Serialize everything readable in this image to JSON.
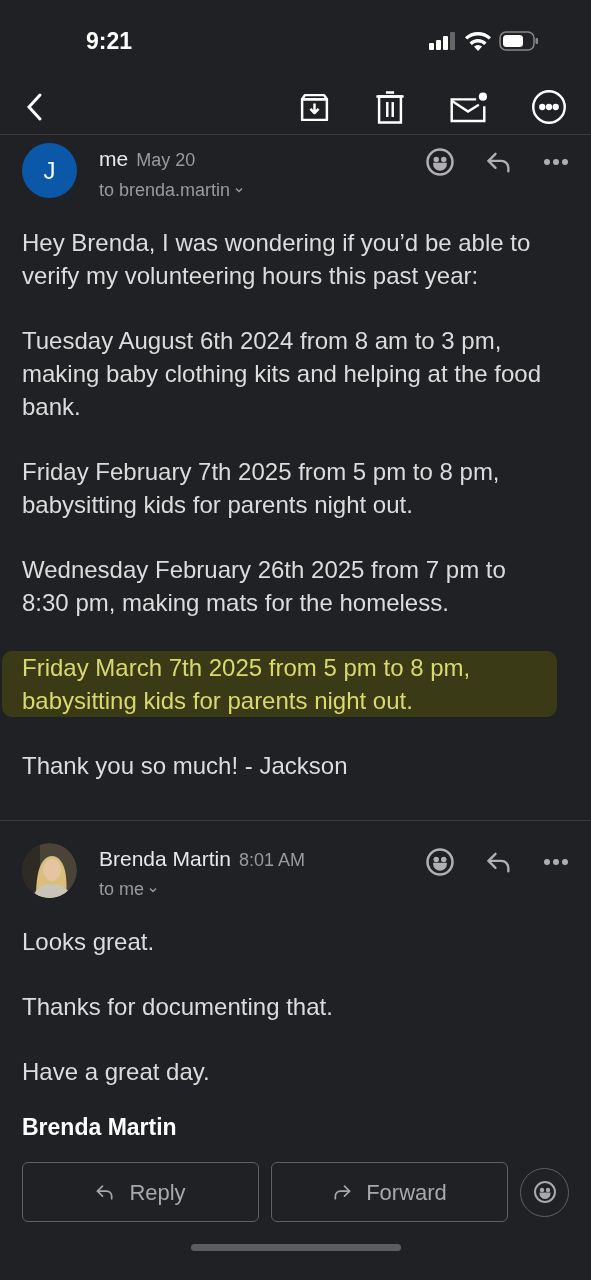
{
  "status_bar": {
    "time": "9:21"
  },
  "messages": [
    {
      "avatar": {
        "kind": "initial",
        "text": "J"
      },
      "sender": "me",
      "date": "May 20",
      "recipient": "to brenda.martin",
      "paragraphs": [
        {
          "text": "Hey Brenda, I was wondering if you’d be able to verify my volunteering hours this past year:",
          "highlighted": false
        },
        {
          "text": "Tuesday August 6th 2024 from 8 am to 3 pm, making baby clothing kits and helping at the food bank.",
          "highlighted": false
        },
        {
          "text": "Friday February 7th 2025 from 5 pm to 8 pm, babysitting kids for parents night out.",
          "highlighted": false
        },
        {
          "text": "Wednesday February 26th 2025 from 7 pm to 8:30 pm, making mats for the homeless.",
          "highlighted": false
        },
        {
          "text": "Friday March 7th 2025 from 5 pm to 8 pm, babysitting kids for parents night out.",
          "highlighted": true
        },
        {
          "text": "Thank you so much! - Jackson",
          "highlighted": false
        }
      ]
    },
    {
      "sender": "Brenda Martin",
      "date": "8:01 AM",
      "recipient": "to me",
      "paragraphs": [
        {
          "text": "Looks great.",
          "highlighted": false
        },
        {
          "text": "Thanks for documenting that.",
          "highlighted": false
        },
        {
          "text": "Have a great day.",
          "highlighted": false
        }
      ],
      "signature": "Brenda Martin"
    }
  ],
  "actions": [
    "Reply",
    "Forward"
  ]
}
